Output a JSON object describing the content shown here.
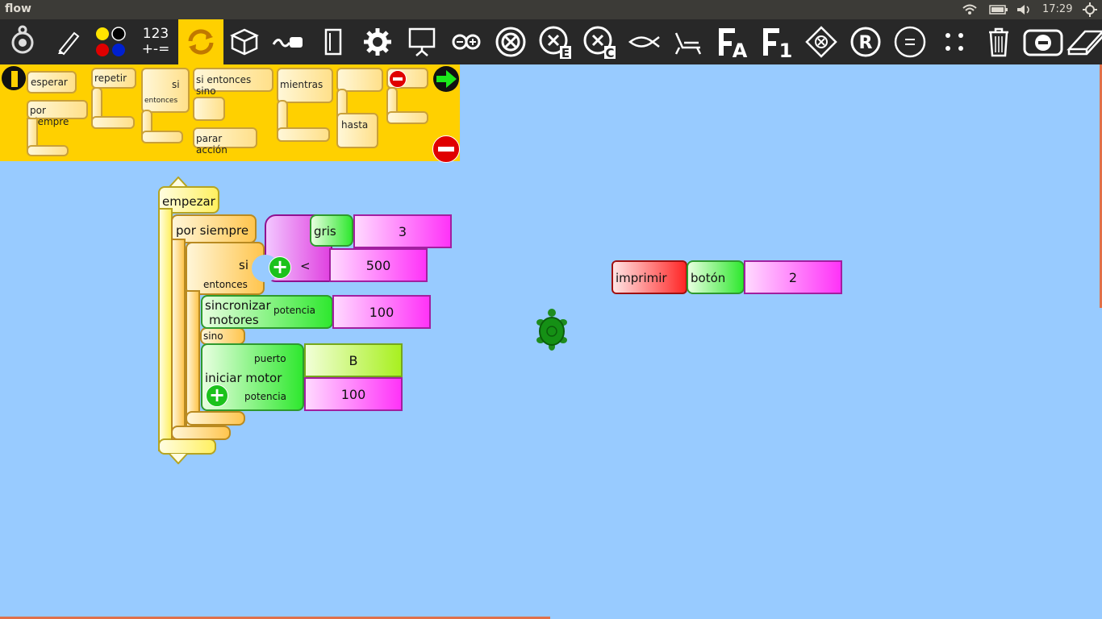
{
  "system_bar": {
    "app_title": "flow",
    "clock": "17:29",
    "icons": [
      "wifi-icon",
      "battery-icon",
      "volume-icon",
      "gear-icon"
    ]
  },
  "toolbar": {
    "number_ops_line1": "123",
    "number_ops_line2": "+-=",
    "icons": [
      "turtle-icon",
      "pen-icon",
      "colors-icon",
      "numbers-icon",
      "flow-icon",
      "sensors-icon",
      "media-icon",
      "blocks-icon",
      "extras-icon",
      "presentation-icon",
      "arduino-icon",
      "close-icon",
      "close-e-icon",
      "close-c-icon",
      "fish-icon",
      "recline-icon",
      "fa-icon",
      "f1-icon",
      "dice-icon",
      "r-icon",
      "equals-icon",
      "dots-icon",
      "trash-icon",
      "stop-icon",
      "eraser-icon"
    ]
  },
  "palette": {
    "esperar": "esperar",
    "por_siempre": "por siempre",
    "repetir": "repetir",
    "si": "si",
    "entonces": "entonces",
    "si_entonces_sino": "si entonces sino",
    "parar_accion": "parar acción",
    "mientras": "mientras",
    "hasta": "hasta"
  },
  "program": {
    "empezar": "empezar",
    "por_siempre": "por siempre",
    "si": "si",
    "entonces": "entonces",
    "sino": "sino",
    "gris": "gris",
    "gris_value": "3",
    "less_than": "<",
    "compare_value": "500",
    "sincronizar_line1": "sincronizar",
    "sincronizar_line2": "motores",
    "potencia": "potencia",
    "sync_potencia_value": "100",
    "iniciar_motor": "iniciar motor",
    "puerto": "puerto",
    "puerto_value": "B",
    "potencia2": "potencia",
    "iniciar_potencia_value": "100"
  },
  "side_program": {
    "imprimir": "imprimir",
    "boton": "botón",
    "boton_value": "2"
  },
  "colors": {
    "canvas": "#98CBFF",
    "toolbar": "#282828",
    "palette": "#FFD000"
  }
}
